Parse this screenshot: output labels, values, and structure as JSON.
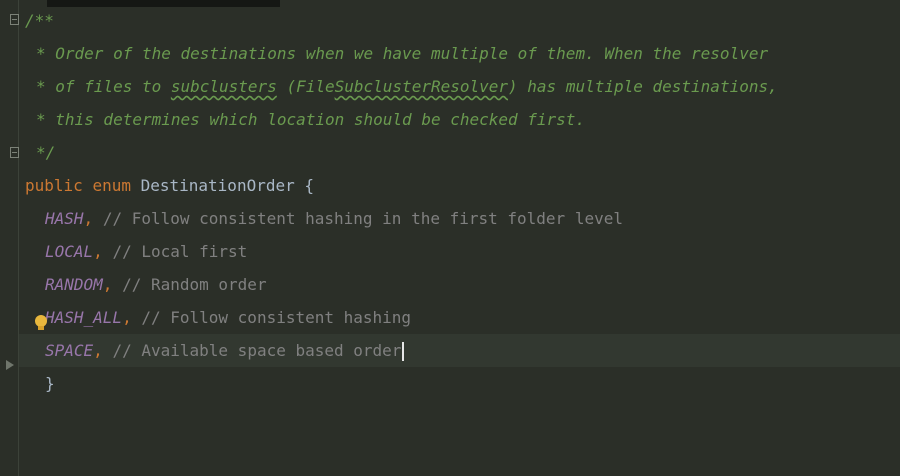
{
  "editor": {
    "lines": {
      "l1": "/**",
      "l2": "* Order of the destinations when we have multiple of them. When the resolver",
      "l3a": "* of files to ",
      "l3b": "subclusters",
      "l3c": " (File",
      "l3d": "SubclusterResolver",
      "l3e": ") has multiple destinations,",
      "l4": "* this determines which location should be checked first.",
      "l5": "*/",
      "l6_kw1": "public",
      "l6_kw2": "enum",
      "l6_name": "DestinationOrder",
      "l6_brace": "{",
      "l7_const": "HASH",
      "l7_comment": "// Follow consistent hashing in the first folder level",
      "l8_const": "LOCAL",
      "l8_comment": "// Local first",
      "l9_const": "RANDOM",
      "l9_comment": "// Random order",
      "l10_const": "HASH_ALL",
      "l10_comment": "// Follow consistent hashing",
      "l11_const": "SPACE",
      "l11_comment": "// Available space based order",
      "l12": "}",
      "comma": ","
    }
  },
  "colors": {
    "background": "#2b2f28",
    "doc_comment": "#6a9a4f",
    "keyword": "#cc7832",
    "enum_constant": "#9876aa",
    "line_comment": "#808080",
    "identifier": "#a9b7c6",
    "intention_bulb": "#e8b73d"
  },
  "icons": [
    "fold-marker-icon",
    "intention-bulb-icon",
    "run-arrow-icon"
  ]
}
